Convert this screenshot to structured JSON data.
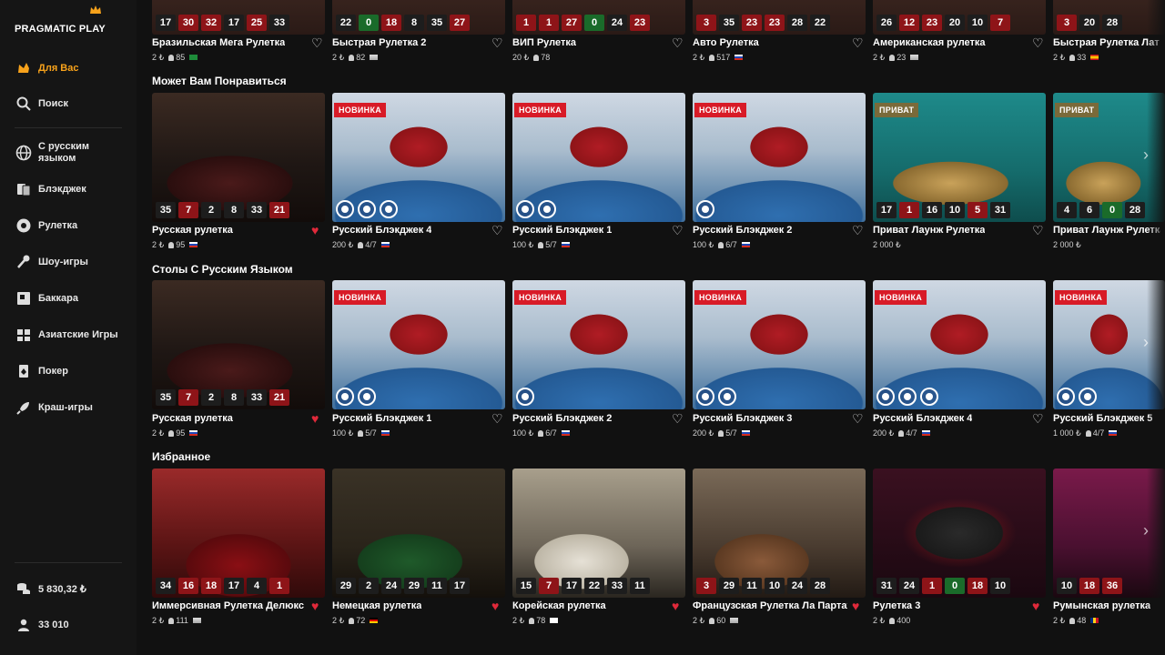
{
  "brand": {
    "name": "PRAGMATIC PLAY"
  },
  "sidebar": {
    "items": [
      {
        "label": "Для Вас",
        "icon": "star-icon",
        "active": true
      },
      {
        "label": "Поиск",
        "icon": "search-icon"
      },
      {
        "label": "С русским\nязыком",
        "icon": "globe-icon"
      },
      {
        "label": "Блэкджек",
        "icon": "blackjack-icon"
      },
      {
        "label": "Рулетка",
        "icon": "roulette-icon"
      },
      {
        "label": "Шоу-игры",
        "icon": "microphone-icon"
      },
      {
        "label": "Баккара",
        "icon": "baccarat-icon"
      },
      {
        "label": "Азиатские Игры",
        "icon": "asian-icon"
      },
      {
        "label": "Покер",
        "icon": "poker-icon"
      },
      {
        "label": "Краш-игры",
        "icon": "rocket-icon"
      }
    ],
    "balance": "5 830,32 ₺",
    "players": "33 010"
  },
  "sections": [
    {
      "title": "",
      "cards": [
        {
          "name": "Бразильская Мега Рулетка",
          "bet": "2 ₺",
          "players": "85",
          "flag": "br",
          "results": [
            [
              "17",
              "black"
            ],
            [
              "30",
              "red"
            ],
            [
              "32",
              "red"
            ],
            [
              "17",
              "black"
            ],
            [
              "25",
              "red"
            ],
            [
              "33",
              "black"
            ]
          ],
          "fav": false
        },
        {
          "name": "Быстрая Рулетка 2",
          "bet": "2 ₺",
          "players": "82",
          "flag": "multi",
          "results": [
            [
              "22",
              "black"
            ],
            [
              "0",
              "green"
            ],
            [
              "18",
              "red"
            ],
            [
              "8",
              "black"
            ],
            [
              "35",
              "black"
            ],
            [
              "27",
              "red"
            ]
          ],
          "fav": false
        },
        {
          "name": "ВИП Рулетка",
          "bet": "20 ₺",
          "players": "78",
          "flag": "",
          "results": [
            [
              "1",
              "red"
            ],
            [
              "1",
              "red"
            ],
            [
              "27",
              "red"
            ],
            [
              "0",
              "green"
            ],
            [
              "24",
              "black"
            ],
            [
              "23",
              "red"
            ]
          ],
          "fav": false
        },
        {
          "name": "Авто Рулетка",
          "bet": "2 ₺",
          "players": "517",
          "flag": "ru",
          "results": [
            [
              "3",
              "red"
            ],
            [
              "35",
              "black"
            ],
            [
              "23",
              "red"
            ],
            [
              "23",
              "red"
            ],
            [
              "28",
              "black"
            ],
            [
              "22",
              "black"
            ]
          ],
          "fav": false
        },
        {
          "name": "Американская рулетка",
          "bet": "2 ₺",
          "players": "23",
          "flag": "multi",
          "results": [
            [
              "26",
              "black"
            ],
            [
              "12",
              "red"
            ],
            [
              "23",
              "red"
            ],
            [
              "20",
              "black"
            ],
            [
              "10",
              "black"
            ],
            [
              "7",
              "red"
            ]
          ],
          "fav": false
        },
        {
          "name": "Быстрая Рулетка Лат",
          "bet": "2 ₺",
          "players": "33",
          "flag": "es",
          "results": [
            [
              "3",
              "red"
            ],
            [
              "20",
              "black"
            ],
            [
              "28",
              "black"
            ]
          ],
          "fav": false
        }
      ]
    },
    {
      "title": "Может Вам Понравиться",
      "cards": [
        {
          "name": "Русская рулетка",
          "bet": "2 ₺",
          "players": "95",
          "flag": "ru",
          "badge": "",
          "results": [
            [
              "35",
              "black"
            ],
            [
              "7",
              "red"
            ],
            [
              "2",
              "black"
            ],
            [
              "8",
              "black"
            ],
            [
              "33",
              "black"
            ],
            [
              "21",
              "red"
            ]
          ],
          "fav": true,
          "scene": "roulette"
        },
        {
          "name": "Русский Блэкджек 4",
          "bet": "200 ₺",
          "players": "4/7",
          "flag": "ru",
          "badge": "НОВИНКА",
          "seats": 3,
          "fav": false,
          "scene": "blackjack"
        },
        {
          "name": "Русский Блэкджек 1",
          "bet": "100 ₺",
          "players": "5/7",
          "flag": "ru",
          "badge": "НОВИНКА",
          "seats": 2,
          "fav": false,
          "scene": "blackjack"
        },
        {
          "name": "Русский Блэкджек 2",
          "bet": "100 ₺",
          "players": "6/7",
          "flag": "ru",
          "badge": "НОВИНКА",
          "seats": 1,
          "fav": false,
          "scene": "blackjack"
        },
        {
          "name": "Приват Лаунж Рулетка",
          "bet": "2 000 ₺",
          "players": "",
          "flag": "",
          "badge": "ПРИВАТ",
          "results": [
            [
              "17",
              "black"
            ],
            [
              "1",
              "red"
            ],
            [
              "16",
              "black"
            ],
            [
              "10",
              "black"
            ],
            [
              "5",
              "red"
            ],
            [
              "31",
              "black"
            ]
          ],
          "fav": false,
          "scene": "private"
        },
        {
          "name": "Приват Лаунж Рулетка",
          "bet": "2 000 ₺",
          "players": "",
          "flag": "",
          "badge": "ПРИВАТ",
          "results": [
            [
              "4",
              "black"
            ],
            [
              "6",
              "black"
            ],
            [
              "0",
              "green"
            ],
            [
              "28",
              "black"
            ]
          ],
          "fav": false,
          "scene": "private"
        }
      ]
    },
    {
      "title": "Столы С Русским Языком",
      "cards": [
        {
          "name": "Русская рулетка",
          "bet": "2 ₺",
          "players": "95",
          "flag": "ru",
          "badge": "",
          "results": [
            [
              "35",
              "black"
            ],
            [
              "7",
              "red"
            ],
            [
              "2",
              "black"
            ],
            [
              "8",
              "black"
            ],
            [
              "33",
              "black"
            ],
            [
              "21",
              "red"
            ]
          ],
          "fav": true,
          "scene": "roulette"
        },
        {
          "name": "Русский Блэкджек 1",
          "bet": "100 ₺",
          "players": "5/7",
          "flag": "ru",
          "badge": "НОВИНКА",
          "seats": 2,
          "fav": false,
          "scene": "blackjack"
        },
        {
          "name": "Русский Блэкджек 2",
          "bet": "100 ₺",
          "players": "6/7",
          "flag": "ru",
          "badge": "НОВИНКА",
          "seats": 1,
          "fav": false,
          "scene": "blackjack"
        },
        {
          "name": "Русский Блэкджек 3",
          "bet": "200 ₺",
          "players": "5/7",
          "flag": "ru",
          "badge": "НОВИНКА",
          "seats": 2,
          "fav": false,
          "scene": "blackjack"
        },
        {
          "name": "Русский Блэкджек 4",
          "bet": "200 ₺",
          "players": "4/7",
          "flag": "ru",
          "badge": "НОВИНКА",
          "seats": 3,
          "fav": false,
          "scene": "blackjack"
        },
        {
          "name": "Русский Блэкджек 5",
          "bet": "1 000 ₺",
          "players": "4/7",
          "flag": "ru",
          "badge": "НОВИНКА",
          "seats": 2,
          "fav": false,
          "scene": "blackjack"
        }
      ]
    },
    {
      "title": "Избранное",
      "cards": [
        {
          "name": "Иммерсивная Рулетка Делюкс",
          "bet": "2 ₺",
          "players": "111",
          "flag": "multi",
          "badge": "",
          "results": [
            [
              "34",
              "black"
            ],
            [
              "16",
              "red"
            ],
            [
              "18",
              "red"
            ],
            [
              "17",
              "black"
            ],
            [
              "4",
              "black"
            ],
            [
              "1",
              "red"
            ]
          ],
          "fav": true,
          "scene": "red-roulette"
        },
        {
          "name": "Немецкая рулетка",
          "bet": "2 ₺",
          "players": "72",
          "flag": "de",
          "badge": "",
          "results": [
            [
              "29",
              "black"
            ],
            [
              "2",
              "black"
            ],
            [
              "24",
              "black"
            ],
            [
              "29",
              "black"
            ],
            [
              "11",
              "black"
            ],
            [
              "17",
              "black"
            ]
          ],
          "fav": true,
          "scene": "green-roulette"
        },
        {
          "name": "Корейская рулетка",
          "bet": "2 ₺",
          "players": "78",
          "flag": "kr",
          "badge": "",
          "results": [
            [
              "15",
              "black"
            ],
            [
              "7",
              "red"
            ],
            [
              "17",
              "black"
            ],
            [
              "22",
              "black"
            ],
            [
              "33",
              "black"
            ],
            [
              "11",
              "black"
            ]
          ],
          "fav": true,
          "scene": "white-roulette"
        },
        {
          "name": "Французская Рулетка Ла Партаж",
          "bet": "2 ₺",
          "players": "60",
          "flag": "multi",
          "badge": "",
          "results": [
            [
              "3",
              "red"
            ],
            [
              "29",
              "black"
            ],
            [
              "11",
              "black"
            ],
            [
              "10",
              "black"
            ],
            [
              "24",
              "black"
            ],
            [
              "28",
              "black"
            ]
          ],
          "fav": true,
          "scene": "brown-roulette"
        },
        {
          "name": "Рулетка 3",
          "bet": "2 ₺",
          "players": "400",
          "flag": "",
          "badge": "",
          "results": [
            [
              "31",
              "black"
            ],
            [
              "24",
              "black"
            ],
            [
              "1",
              "red"
            ],
            [
              "0",
              "green"
            ],
            [
              "18",
              "red"
            ],
            [
              "10",
              "black"
            ]
          ],
          "fav": true,
          "scene": "wheel"
        },
        {
          "name": "Румынская рулетка",
          "bet": "2 ₺",
          "players": "48",
          "flag": "ro",
          "badge": "",
          "results": [
            [
              "10",
              "black"
            ],
            [
              "18",
              "red"
            ],
            [
              "36",
              "red"
            ]
          ],
          "fav": false,
          "scene": "purple-roulette"
        }
      ]
    }
  ],
  "colors": {
    "accent": "#f7a21b",
    "new_badge": "#d81b27",
    "red": "#8e1418",
    "green": "#1a6b2a",
    "black": "#1d1d1d"
  }
}
